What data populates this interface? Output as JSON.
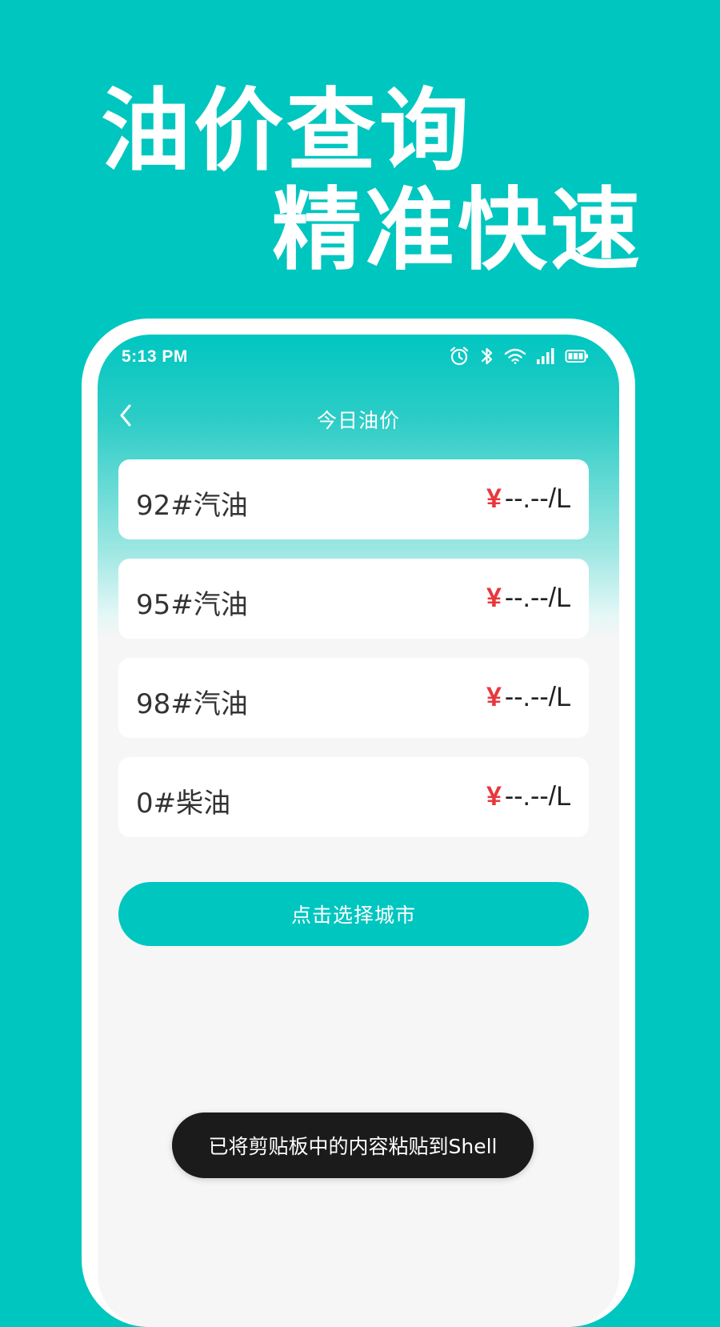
{
  "promo": {
    "headline_line1": "油价查询",
    "headline_line2": "精准快速"
  },
  "status_bar": {
    "time": "5:13 PM",
    "icons": [
      "alarm-icon",
      "bluetooth-icon",
      "wifi-icon",
      "signal-icon",
      "battery-icon"
    ]
  },
  "nav": {
    "back_icon": "chevron-left-icon",
    "title": "今日油价"
  },
  "fuel_prices": [
    {
      "name": "92#汽油",
      "currency": "¥",
      "price": "--.--/L"
    },
    {
      "name": "95#汽油",
      "currency": "¥",
      "price": "--.--/L"
    },
    {
      "name": "98#汽油",
      "currency": "¥",
      "price": "--.--/L"
    },
    {
      "name": "0#柴油",
      "currency": "¥",
      "price": "--.--/L"
    }
  ],
  "select_city_button": "点击选择城市",
  "toast": "已将剪贴板中的内容粘贴到Shell",
  "colors": {
    "brand_teal": "#00c6c0",
    "price_currency_red": "#e8383d",
    "card_background": "#ffffff",
    "page_background": "#f6f6f6",
    "toast_background": "#1b1b1b"
  }
}
